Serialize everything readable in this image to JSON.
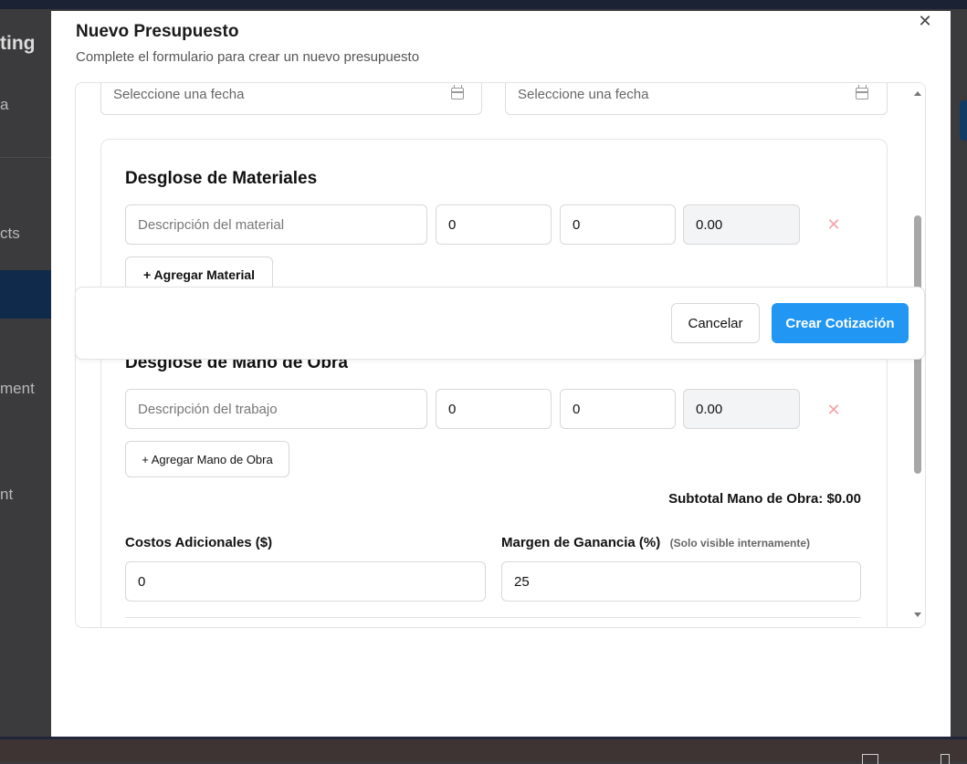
{
  "background": {
    "brand_fragment": "ting",
    "sidebar_fragments": [
      "a",
      "cts",
      "ment",
      "nt"
    ]
  },
  "modal": {
    "title": "Nuevo Presupuesto",
    "subtitle": "Complete el formulario para crear un nuevo presupuesto",
    "close_icon": "close-icon"
  },
  "dates": {
    "start_placeholder": "Seleccione una fecha",
    "end_placeholder": "Seleccione una fecha",
    "icon": "calendar-icon"
  },
  "materials": {
    "heading": "Desglose de Materiales",
    "row": {
      "description_placeholder": "Descripción del material",
      "quantity": "0",
      "unit_price": "0",
      "total": "0.00"
    },
    "add_button": "+ Agregar Material"
  },
  "labor": {
    "heading": "Desglose de Mano de Obra",
    "row": {
      "description_placeholder": "Descripción del trabajo",
      "hours": "0",
      "rate": "0",
      "total": "0.00"
    },
    "add_button": "+ Agregar Mano de Obra",
    "subtotal": "Subtotal Mano de Obra: $0.00"
  },
  "extra": {
    "additional_costs_label": "Costos Adicionales ($)",
    "additional_costs_value": "0",
    "margin_label": "Margen de Ganancia (%)",
    "margin_hint": "(Solo visible internamente)",
    "margin_value": "25"
  },
  "footer": {
    "cancel": "Cancelar",
    "submit": "Crear Cotización"
  },
  "colors": {
    "primary": "#2196f3",
    "delete": "#f3a3a8",
    "overlay": "#3a3a3c"
  }
}
